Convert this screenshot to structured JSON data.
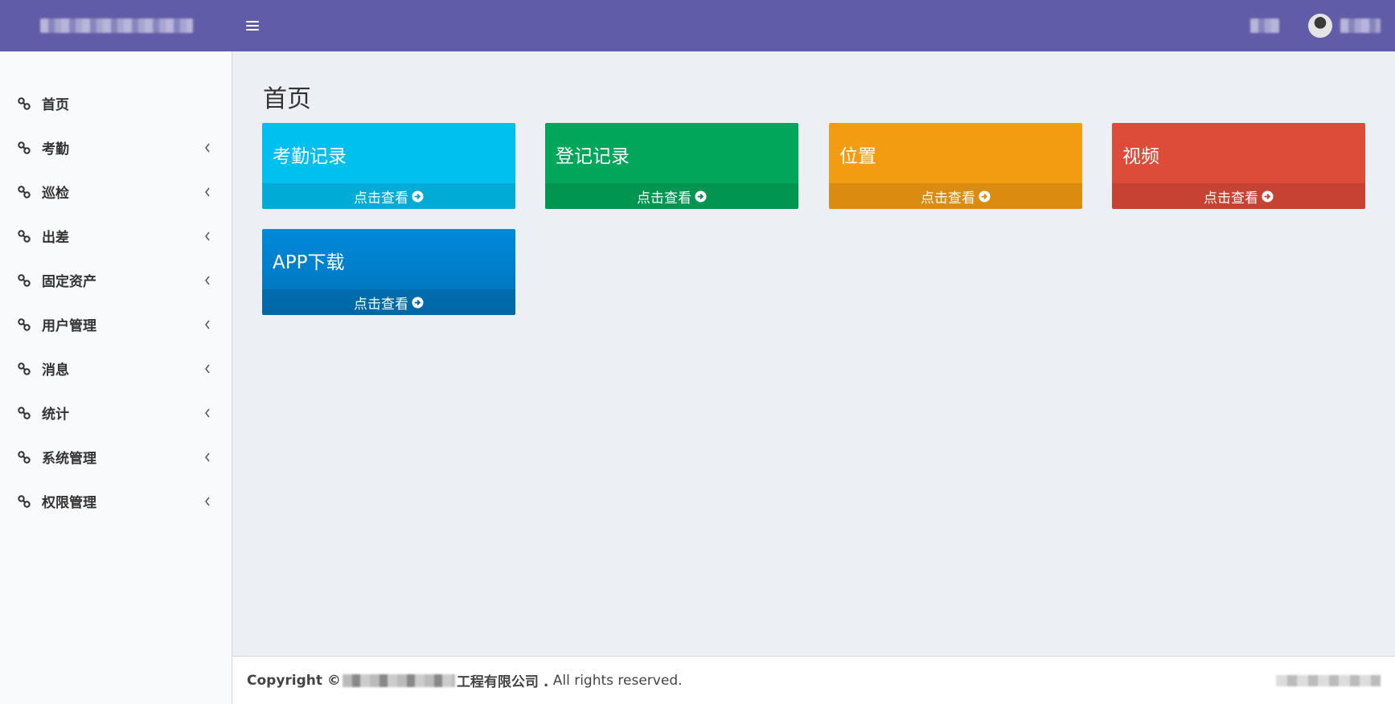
{
  "sidebar": {
    "items": [
      {
        "label": "首页",
        "has_submenu": false
      },
      {
        "label": "考勤",
        "has_submenu": true
      },
      {
        "label": "巡检",
        "has_submenu": true
      },
      {
        "label": "出差",
        "has_submenu": true
      },
      {
        "label": "固定资产",
        "has_submenu": true
      },
      {
        "label": "用户管理",
        "has_submenu": true
      },
      {
        "label": "消息",
        "has_submenu": true
      },
      {
        "label": "统计",
        "has_submenu": true
      },
      {
        "label": "系统管理",
        "has_submenu": true
      },
      {
        "label": "权限管理",
        "has_submenu": true
      }
    ]
  },
  "main": {
    "title": "首页",
    "boxes": [
      {
        "title": "考勤记录",
        "link": "点击查看",
        "color": "#00c0ef"
      },
      {
        "title": "登记记录",
        "link": "点击查看",
        "color": "#00a65a"
      },
      {
        "title": "位置",
        "link": "点击查看",
        "color": "#f39c12"
      },
      {
        "title": "视频",
        "link": "点击查看",
        "color": "#dd4b39"
      },
      {
        "title": "APP下载",
        "link": "点击查看",
        "color": "#0073b7"
      }
    ]
  },
  "footer": {
    "copyright_prefix": "Copyright ©",
    "company_suffix": "工程有限公司 .",
    "rights": " All rights reserved."
  },
  "colors": {
    "header_bg": "#605ca8",
    "sidebar_bg": "#f9fafc",
    "content_bg": "#ecf0f5"
  }
}
